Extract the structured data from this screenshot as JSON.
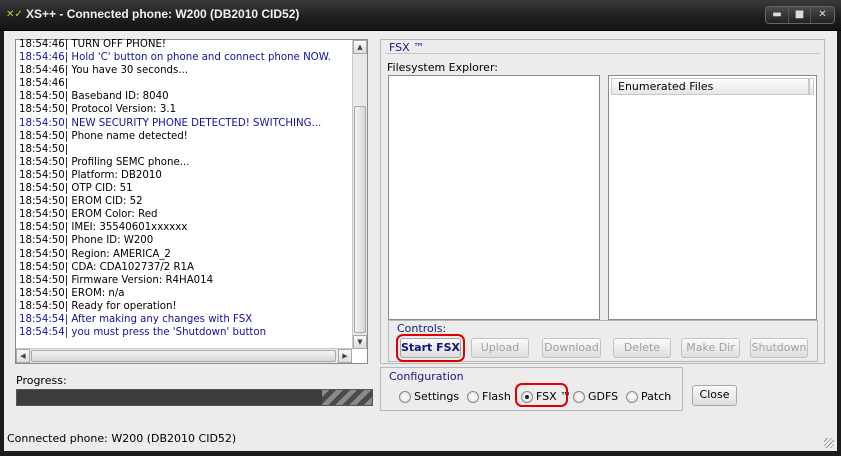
{
  "window": {
    "title": "XS++ - Connected phone: W200 (DB2010 CID52)",
    "app_icon": "xs-icon",
    "controls": [
      "minimize",
      "maximize",
      "close"
    ]
  },
  "log": {
    "lines": [
      {
        "text": "18:54:46| TURN OFF PHONE!",
        "color": "black"
      },
      {
        "text": "18:54:46| Hold 'C' button on phone and connect phone NOW.",
        "color": "blue"
      },
      {
        "text": "18:54:46| You have 30 seconds...",
        "color": "black"
      },
      {
        "text": "18:54:46|",
        "color": "black"
      },
      {
        "text": "18:54:50| Baseband ID: 8040",
        "color": "black"
      },
      {
        "text": "18:54:50| Protocol Version: 3.1",
        "color": "black"
      },
      {
        "text": "18:54:50| NEW SECURITY PHONE DETECTED! SWITCHING...",
        "color": "blue"
      },
      {
        "text": "18:54:50| Phone name detected!",
        "color": "black"
      },
      {
        "text": "18:54:50|",
        "color": "black"
      },
      {
        "text": "18:54:50| Profiling SEMC phone...",
        "color": "black"
      },
      {
        "text": "18:54:50| Platform: DB2010",
        "color": "black"
      },
      {
        "text": "18:54:50| OTP CID: 51",
        "color": "black"
      },
      {
        "text": "18:54:50| EROM CID: 52",
        "color": "black"
      },
      {
        "text": "18:54:50| EROM Color: Red",
        "color": "black"
      },
      {
        "text": "18:54:50| IMEI: 35540601xxxxxx",
        "color": "black"
      },
      {
        "text": "18:54:50| Phone ID: W200",
        "color": "black"
      },
      {
        "text": "18:54:50| Region: AMERICA_2",
        "color": "black"
      },
      {
        "text": "18:54:50| CDA: CDA102737/2   R1A",
        "color": "black"
      },
      {
        "text": "18:54:50| Firmware Version: R4HA014",
        "color": "black"
      },
      {
        "text": "18:54:50| EROM: n/a",
        "color": "black"
      },
      {
        "text": "18:54:50| Ready for operation!",
        "color": "black"
      },
      {
        "text": "18:54:54| After making any changes with FSX",
        "color": "blue"
      },
      {
        "text": "18:54:54| you must press the 'Shutdown' button",
        "color": "blue"
      }
    ]
  },
  "progress": {
    "label": "Progress:"
  },
  "fsx": {
    "title": "FSX ™",
    "explorer_label": "Filesystem Explorer:",
    "files_header": "Enumerated Files",
    "controls_label": "Controls:",
    "buttons": {
      "start": "Start FSX",
      "upload": "Upload",
      "download": "Download",
      "delete": "Delete",
      "make_dir": "Make Dir",
      "shutdown": "Shutdown"
    }
  },
  "configuration": {
    "title": "Configuration",
    "options": [
      "Settings",
      "Flash",
      "FSX ™",
      "GDFS",
      "Patch"
    ],
    "selected": "FSX ™"
  },
  "close_label": "Close",
  "status": "Connected phone: W200 (DB2010 CID52)",
  "colors": {
    "log_blue": "#1212a0",
    "highlight_red": "#e00000",
    "title_bar": "#1e1e1e"
  }
}
